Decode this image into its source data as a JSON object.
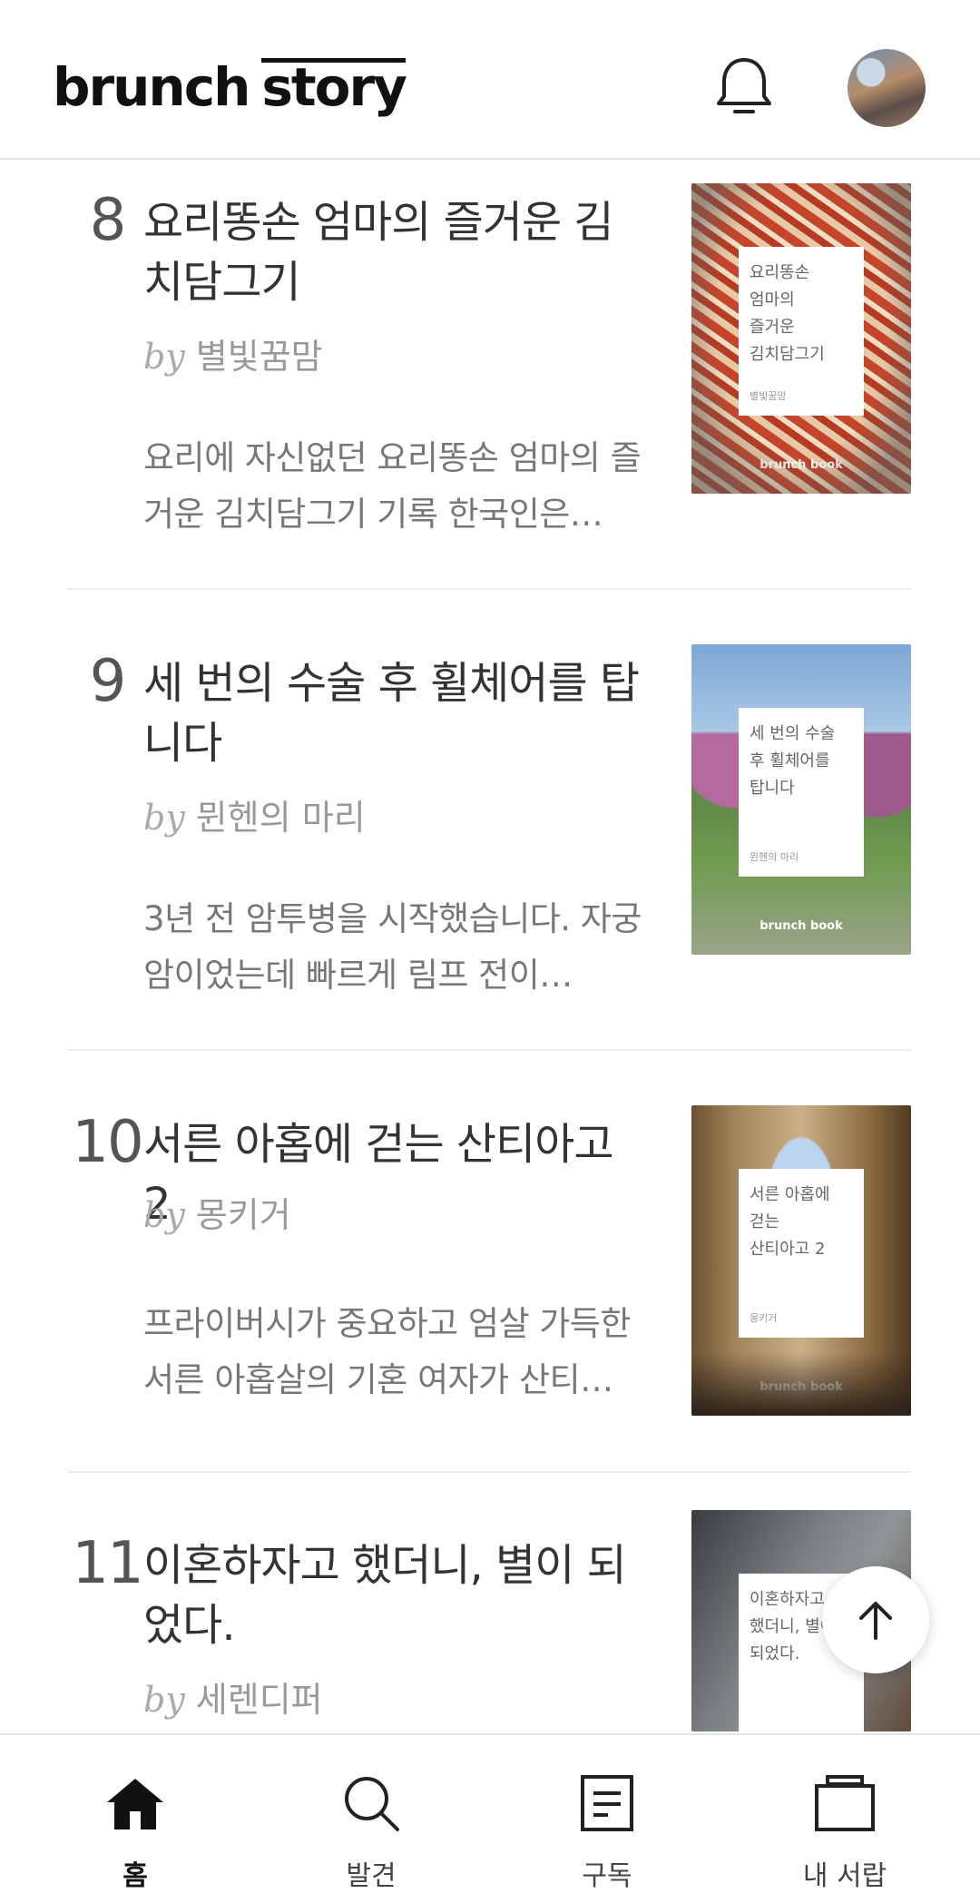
{
  "header": {
    "logo_part1": "brunch",
    "logo_part2": "story",
    "icons": [
      "bell-icon",
      "avatar"
    ]
  },
  "items": [
    {
      "rank": "8",
      "title": "요리똥손 엄마의 즐거운 김치담그기",
      "by_prefix": "by",
      "author": "별빛꿈맘",
      "excerpt": "요리에 자신없던 요리똥손 엄마의 즐거운 김치담그기 기록 한국인은…",
      "cover": {
        "title": "요리똥손\n엄마의\n즐거운\n김치담그기",
        "author": "별빛꿈맘",
        "brand": "brunch book"
      }
    },
    {
      "rank": "9",
      "title": "세 번의 수술 후 휠체어를 탑니다",
      "by_prefix": "by",
      "author": "뮌헨의 마리",
      "excerpt": "3년 전 암투병을 시작했습니다. 자궁암이었는데 빠르게 림프 전이…",
      "cover": {
        "title": "세 번의 수술\n후 휠체어를\n탑니다",
        "author": "뮌헨의 마리",
        "brand": "brunch book"
      }
    },
    {
      "rank": "10",
      "title": "서른 아홉에 걷는 산티아고 2",
      "by_prefix": "by",
      "author": "몽키거",
      "excerpt": "프라이버시가 중요하고 엄살 가득한 서른 아홉살의 기혼 여자가 산티…",
      "cover": {
        "title": "서른 아홉에\n걷는\n산티아고 2",
        "author": "몽키거",
        "brand": "brunch book"
      }
    },
    {
      "rank": "11",
      "title": "이혼하자고 했더니, 별이 되었다.",
      "by_prefix": "by",
      "author": "세렌디퍼",
      "cover": {
        "title": "이혼하자고\n했더니, 별이\n되었다."
      }
    }
  ],
  "fab": {
    "icon": "arrow-up-icon"
  },
  "nav": [
    {
      "label": "홈",
      "icon": "home-icon",
      "active": true
    },
    {
      "label": "발견",
      "icon": "search-icon",
      "active": false
    },
    {
      "label": "구독",
      "icon": "document-icon",
      "active": false
    },
    {
      "label": "내 서랍",
      "icon": "drawer-icon",
      "active": false
    }
  ]
}
